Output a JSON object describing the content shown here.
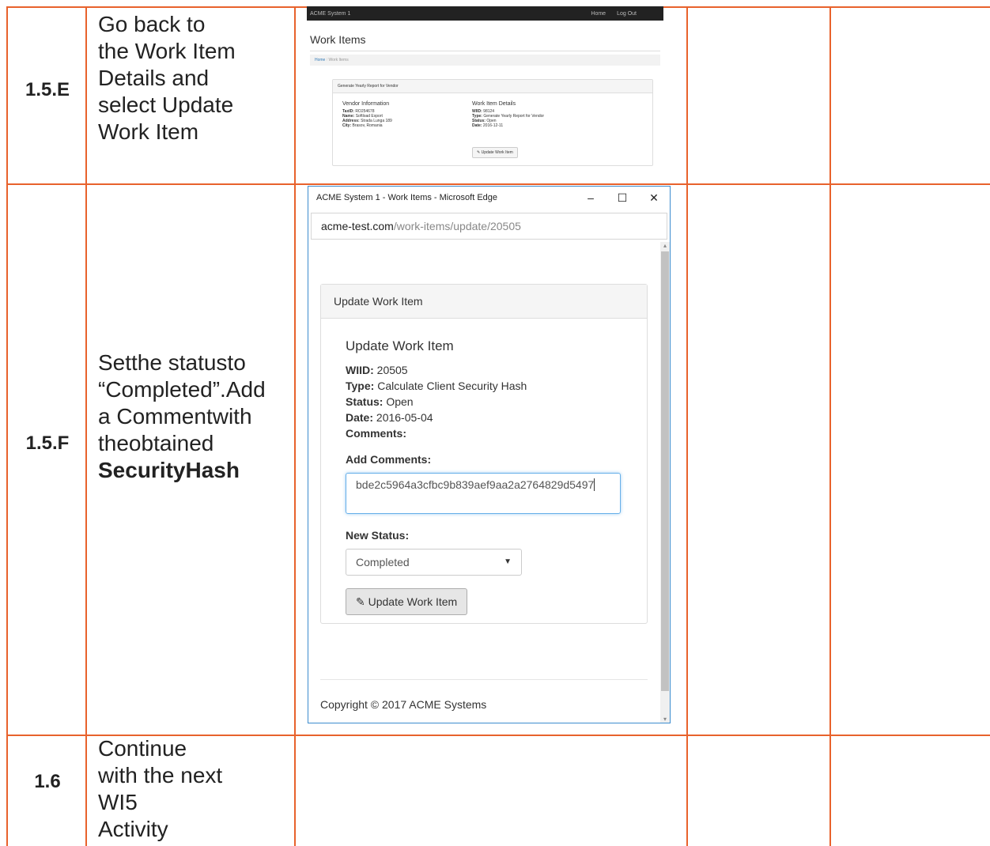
{
  "rows": [
    {
      "id": "1.5.E",
      "text": [
        "Go back to",
        "the Work Item",
        "Details and",
        "select Update",
        "Work Item"
      ]
    },
    {
      "id": "1.5.F",
      "text": [
        "Setthe statusto",
        "“Completed”.Add",
        "a Commentwith",
        "theobtained"
      ],
      "bold_text": "SecurityHash"
    },
    {
      "id": "1.6",
      "text": [
        "Continue",
        "with the next",
        "WI5",
        "Activity"
      ]
    }
  ],
  "shot1": {
    "brand": "ACME System 1",
    "nav": [
      "Home",
      "Log Out"
    ],
    "page_title": "Work Items",
    "breadcrumb": [
      "Home",
      "Work Items"
    ],
    "panel_title": "Generate Yearly Report for Vendor",
    "vendor": {
      "heading": "Vendor Information",
      "taxid_label": "TaxID:",
      "taxid": "RO254678",
      "name_label": "Name:",
      "name": "Softload Export",
      "address_label": "Address:",
      "address": "Strada Lunga 189",
      "city_label": "City:",
      "city": "Brasov, Romania"
    },
    "details": {
      "heading": "Work Item Details",
      "wiid_label": "WIID:",
      "wiid": "98124",
      "type_label": "Type:",
      "type": "Generate Yearly Report for Vendor",
      "status_label": "Status:",
      "status": "Open",
      "date_label": "Date:",
      "date": "2016-12-11"
    },
    "button": "Update Work Item"
  },
  "shot2": {
    "window_title": "ACME System 1 - Work Items - Microsoft Edge",
    "url_host": "acme-test.com",
    "url_path": "/work-items/update/20505",
    "panel_header": "Update Work Item",
    "form_title": "Update Work Item",
    "wiid_label": "WIID:",
    "wiid": "20505",
    "type_label": "Type:",
    "type": "Calculate Client Security Hash",
    "status_label": "Status:",
    "status": "Open",
    "date_label": "Date:",
    "date": "2016-05-04",
    "comments_label": "Comments:",
    "add_comments_label": "Add Comments:",
    "comment_value": "bde2c5964a3cfbc9b839aef9aa2a2764829d5497",
    "new_status_label": "New Status:",
    "new_status_value": "Completed",
    "update_button": "Update Work Item",
    "footer": "Copyright © 2017 ACME Systems"
  }
}
